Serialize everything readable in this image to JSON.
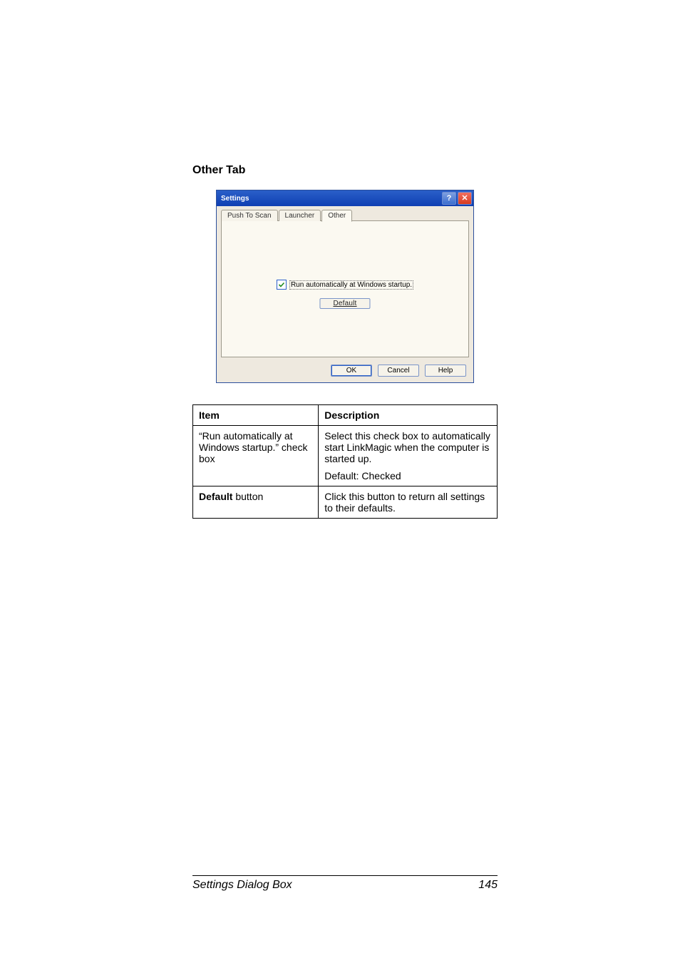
{
  "section": {
    "heading": "Other Tab"
  },
  "dialog": {
    "title": "Settings",
    "help_symbol": "?",
    "close_symbol": "✕",
    "tabs": {
      "push": "Push To Scan",
      "launcher": "Launcher",
      "other": "Other"
    },
    "checkbox_label": "Run automatically at Windows startup.",
    "default_btn": "Default",
    "ok": "OK",
    "cancel": "Cancel",
    "help": "Help"
  },
  "table": {
    "head_item": "Item",
    "head_desc": "Description",
    "row1_item": "“Run automatically at Windows startup.” check box",
    "row1_desc_a": "Select this check box to automatically start LinkMagic when the computer is started up.",
    "row1_desc_b": "Default: Checked",
    "row2_item_strong": "Default",
    "row2_item_tail": " button",
    "row2_desc": "Click this button to return all settings to their defaults."
  },
  "footer": {
    "title": "Settings Dialog Box",
    "page": "145"
  }
}
